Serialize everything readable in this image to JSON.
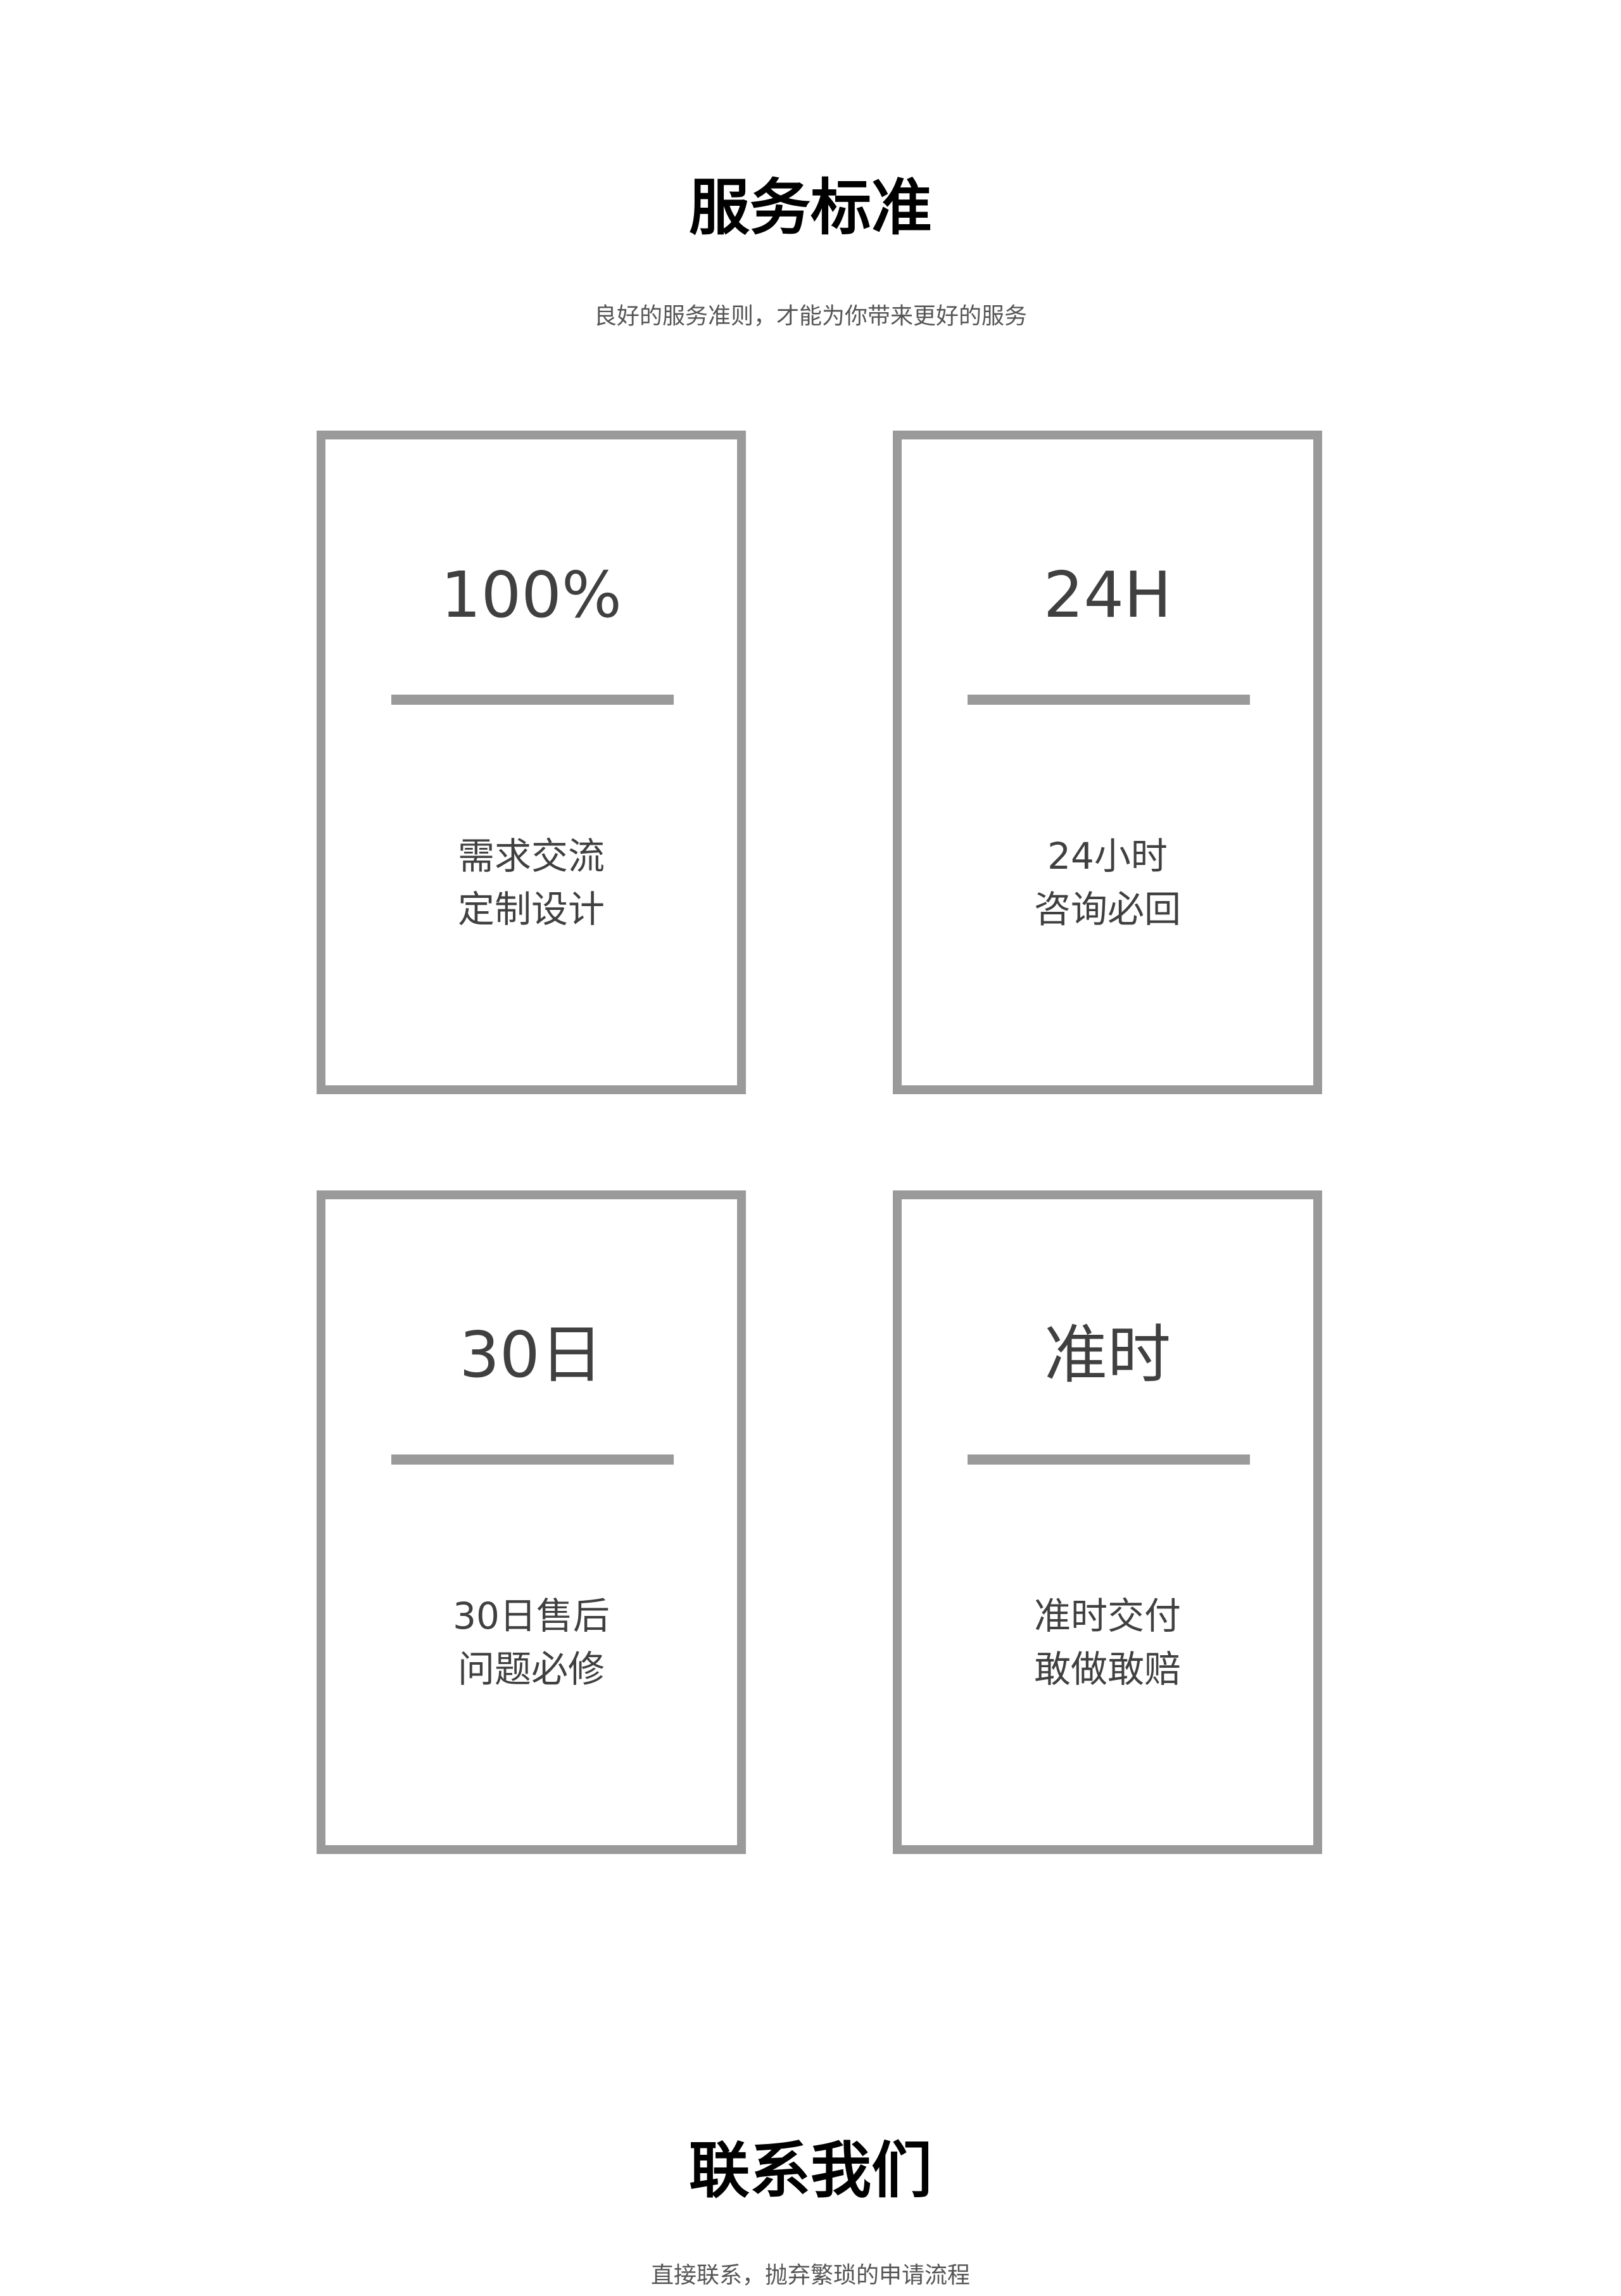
{
  "service_standards": {
    "title": "服务标准",
    "subtitle": "良好的服务准则，才能为你带来更好的服务",
    "cards": [
      {
        "stat": "100%",
        "line1": "需求交流",
        "line2": "定制设计"
      },
      {
        "stat": "24H",
        "line1": "24小时",
        "line2": "咨询必回"
      },
      {
        "stat": "30日",
        "line1": "30日售后",
        "line2": "问题必修"
      },
      {
        "stat": "准时",
        "line1": "准时交付",
        "line2": "敢做敢赔"
      }
    ]
  },
  "contact": {
    "title": "联系我们",
    "subtitle": "直接联系，抛弃繁琐的申请流程"
  },
  "colors": {
    "card_border": "#9a9a9a",
    "card_text": "#404040",
    "title_text": "#000000",
    "subtitle_text": "#555555"
  }
}
